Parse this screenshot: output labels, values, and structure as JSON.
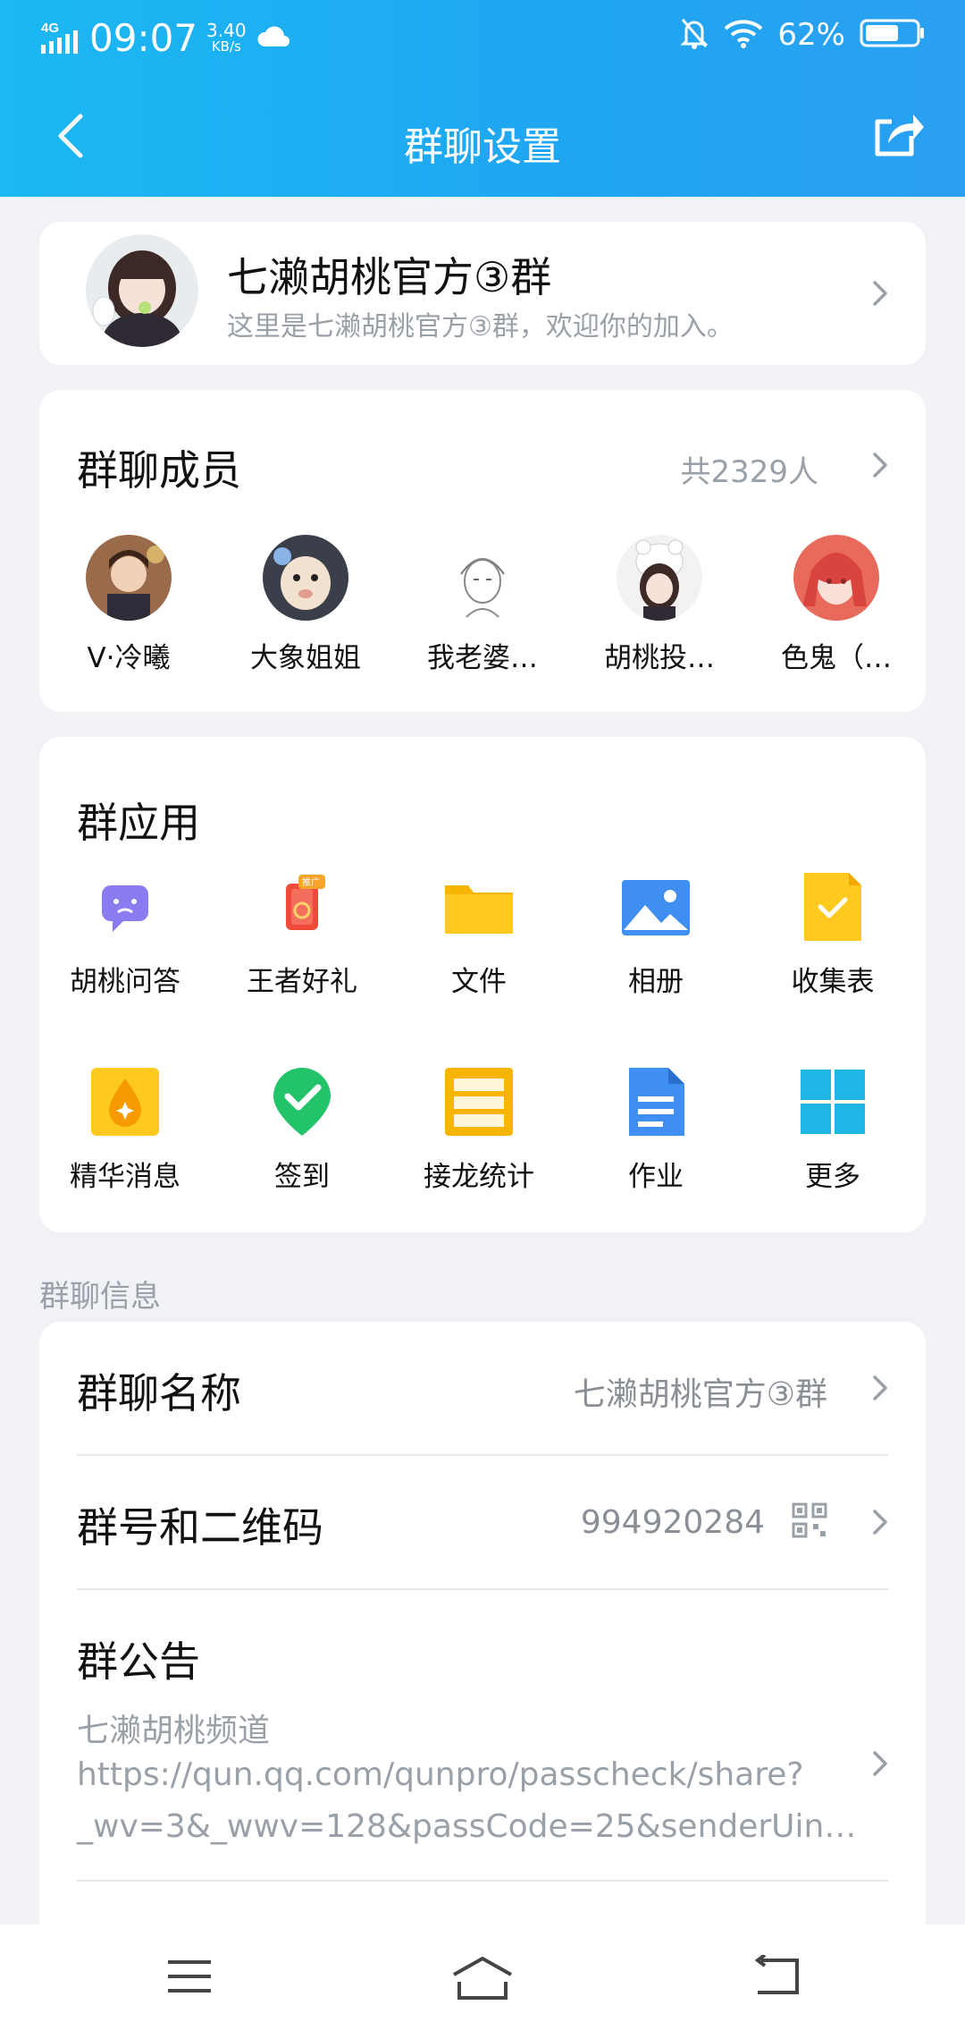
{
  "status_bar": {
    "network": "4G",
    "time": "09:07",
    "speed_value": "3.40",
    "speed_unit": "KB/s",
    "battery": "62%"
  },
  "nav": {
    "title": "群聊设置"
  },
  "group": {
    "name": "七濑胡桃官方③群",
    "description": "这里是七濑胡桃官方③群，欢迎你的加入。"
  },
  "members": {
    "title": "群聊成员",
    "count": "共2329人",
    "items": [
      {
        "name": "V·冷曦"
      },
      {
        "name": "大象姐姐"
      },
      {
        "name": "我老婆…"
      },
      {
        "name": "胡桃投…"
      },
      {
        "name": "色鬼（…"
      }
    ]
  },
  "apps": {
    "title": "群应用",
    "items": [
      {
        "label": "胡桃问答",
        "icon": "qa-bubble-icon"
      },
      {
        "label": "王者好礼",
        "icon": "gift-icon"
      },
      {
        "label": "文件",
        "icon": "folder-icon"
      },
      {
        "label": "相册",
        "icon": "photo-icon"
      },
      {
        "label": "收集表",
        "icon": "form-check-icon"
      },
      {
        "label": "精华消息",
        "icon": "essence-drop-icon"
      },
      {
        "label": "签到",
        "icon": "checkin-pin-icon"
      },
      {
        "label": "接龙统计",
        "icon": "list-icon"
      },
      {
        "label": "作业",
        "icon": "homework-doc-icon"
      },
      {
        "label": "更多",
        "icon": "grid-more-icon"
      }
    ],
    "promo_badge": "推广"
  },
  "info": {
    "section_label": "群聊信息",
    "name_label": "群聊名称",
    "name_value": "七濑胡桃官方③群",
    "number_label": "群号和二维码",
    "number_value": "994920284",
    "notice_label": "群公告",
    "notice_line1": "七濑胡桃频道",
    "notice_line2": "https://qun.qq.com/qunpro/passcheck/share?",
    "notice_line3": "_wv=3&_wwv=128&passCode=25&senderUin…"
  },
  "colors": {
    "header_start": "#1bb8f3",
    "header_end": "#2aa0f0",
    "page_bg": "#f1f2f6",
    "muted_text": "#9aa0a8"
  }
}
